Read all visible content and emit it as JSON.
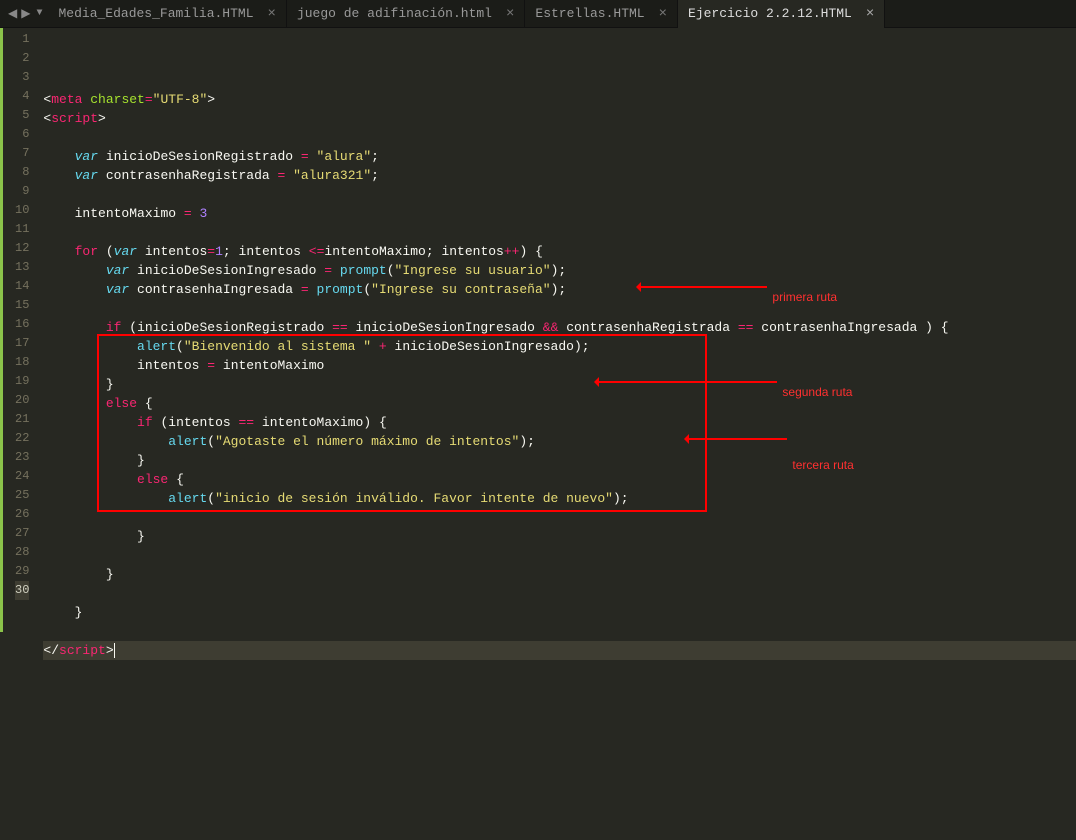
{
  "tabs": [
    {
      "label": "Media_Edades_Familia.HTML",
      "active": false
    },
    {
      "label": "juego de adifinación.html",
      "active": false
    },
    {
      "label": "Estrellas.HTML",
      "active": false
    },
    {
      "label": "Ejercicio 2.2.12.HTML",
      "active": true
    }
  ],
  "nav": {
    "back": "◀",
    "forward": "▶",
    "dropdown": "▼"
  },
  "line_numbers": [
    "1",
    "2",
    "3",
    "4",
    "5",
    "6",
    "7",
    "8",
    "9",
    "10",
    "11",
    "12",
    "13",
    "14",
    "15",
    "16",
    "17",
    "18",
    "19",
    "20",
    "21",
    "22",
    "23",
    "24",
    "25",
    "26",
    "27",
    "28",
    "29",
    "30"
  ],
  "current_line": 30,
  "code": {
    "l1": {
      "open": "<",
      "tag": "meta",
      "attr": "charset",
      "eq": "=",
      "val": "\"UTF-8\"",
      "close": ">"
    },
    "l2": {
      "open": "<",
      "tag": "script",
      "close": ">"
    },
    "l4": {
      "var": "var",
      "id": "inicioDeSesionRegistrado",
      "op": "=",
      "val": "\"alura\"",
      "semi": ";"
    },
    "l5": {
      "var": "var",
      "id": "contrasenhaRegistrada",
      "op": "=",
      "val": "\"alura321\"",
      "semi": ";"
    },
    "l7": {
      "id": "intentoMaximo",
      "op": "=",
      "val": "3"
    },
    "l9": {
      "for": "for",
      "lp": "(",
      "var": "var",
      "id": "intentos",
      "eq": "=",
      "one": "1",
      "semi1": ";",
      "id2": "intentos",
      "lte": "<=",
      "id3": "intentoMaximo",
      "semi2": ";",
      "id4": "intentos",
      "inc": "++",
      "rp": ")",
      "lb": "{"
    },
    "l10": {
      "var": "var",
      "id": "inicioDeSesionIngresado",
      "op": "=",
      "fn": "prompt",
      "lp": "(",
      "val": "\"Ingrese su usuario\"",
      "rp": ")",
      "semi": ";"
    },
    "l11": {
      "var": "var",
      "id": "contrasenhaIngresada",
      "op": "=",
      "fn": "prompt",
      "lp": "(",
      "val": "\"Ingrese su contraseña\"",
      "rp": ")",
      "semi": ";"
    },
    "l13": {
      "if": "if",
      "lp": "(",
      "a": "inicioDeSesionRegistrado",
      "eq": "==",
      "b": "inicioDeSesionIngresado",
      "and": "&&",
      "c": "contrasenhaRegistrada",
      "eq2": "==",
      "d": "contrasenhaIngresada",
      "rp": " )",
      "lb": "{"
    },
    "l14": {
      "fn": "alert",
      "lp": "(",
      "s": "\"Bienvenido al sistema \"",
      "plus": "+",
      "id": "inicioDeSesionIngresado",
      "rp": ")",
      "semi": ";"
    },
    "l15": {
      "a": "intentos",
      "op": "=",
      "b": "intentoMaximo"
    },
    "l16": {
      "rb": "}"
    },
    "l17": {
      "else": "else",
      "lb": "{"
    },
    "l18": {
      "if": "if",
      "lp": "(",
      "a": "intentos",
      "eq": "==",
      "b": "intentoMaximo",
      "rp": ")",
      "lb": "{"
    },
    "l19": {
      "fn": "alert",
      "lp": "(",
      "s": "\"Agotaste el número máximo de intentos\"",
      "rp": ")",
      "semi": ";"
    },
    "l20": {
      "rb": "}"
    },
    "l21": {
      "else": "else",
      "lb": "{"
    },
    "l22": {
      "fn": "alert",
      "lp": "(",
      "s": "\"inicio de sesión inválido. Favor intente de nuevo\"",
      "rp": ")",
      "semi": ";"
    },
    "l24": {
      "rb": "}"
    },
    "l26": {
      "rb": "}"
    },
    "l28": {
      "rb": "}"
    },
    "l30": {
      "open": "</",
      "tag": "script",
      "close": ">"
    }
  },
  "annotations": {
    "route1": "primera ruta",
    "route2": "segunda ruta",
    "route3": "tercera ruta"
  }
}
